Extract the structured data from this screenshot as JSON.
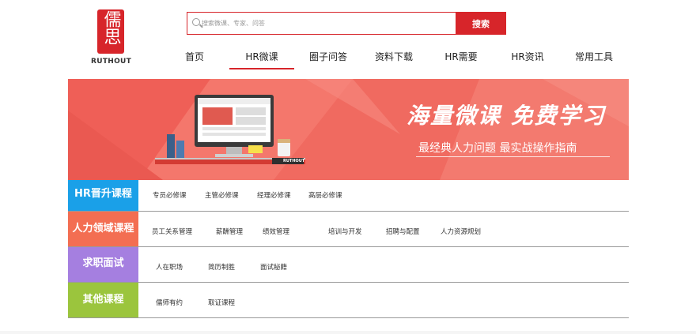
{
  "header": {
    "logo_glyphs": "儒思",
    "logo_text": "RUTHOUT",
    "search_placeholder": "搜索微课、专家、问答",
    "search_button": "搜索"
  },
  "nav": {
    "items": [
      "首页",
      "HR微课",
      "圈子问答",
      "资料下载",
      "HR需要",
      "HR资讯",
      "常用工具"
    ],
    "active_index": 1
  },
  "banner": {
    "title": "海量微课  免费学习",
    "subtitle": "最经典人力问题  最实战操作指南",
    "screen_brand": "RUTHOUT"
  },
  "categories": [
    {
      "label": "HR晋升课程",
      "color": "#1aa0e8",
      "links": [
        "专员必修课",
        "主管必修课",
        "经理必修课",
        "高层必修课"
      ]
    },
    {
      "label": "人力领域课程",
      "color": "#f36e52",
      "links": [
        "员工关系管理",
        "薪酬管理",
        "绩效管理",
        "培训与开发",
        "招聘与配置",
        "人力资源规划"
      ]
    },
    {
      "label": "求职面试",
      "color": "#a57fe0",
      "links": [
        "人在职场",
        "简历制胜",
        "面试秘籍"
      ]
    },
    {
      "label": "其他课程",
      "color": "#9bc53d",
      "links": [
        "儒师有约",
        "取证课程"
      ]
    }
  ],
  "colors": {
    "brand_red": "#d7252a",
    "banner_bg": "#f26a60"
  }
}
